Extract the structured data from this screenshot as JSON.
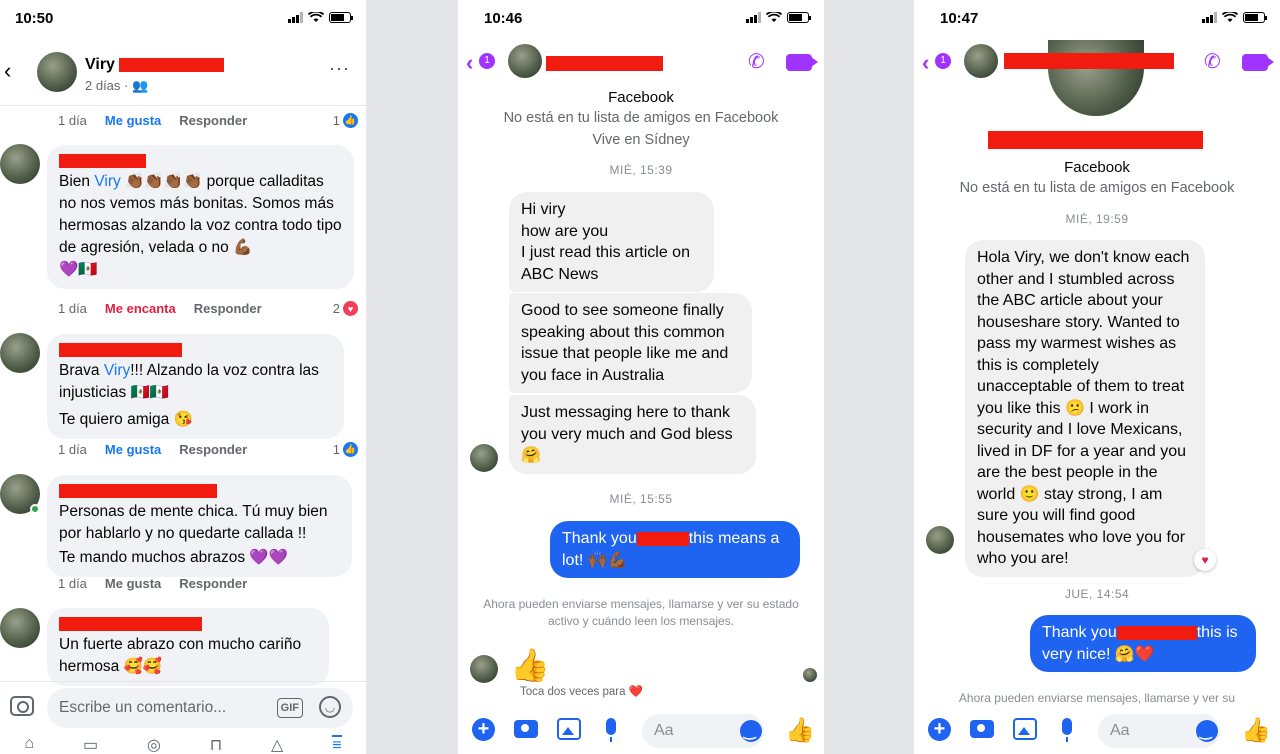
{
  "panel1": {
    "status_time": "10:50",
    "header": {
      "name": "Viry",
      "time": "2 días · ",
      "more": "···"
    },
    "top_meta": {
      "time": "1 día",
      "like": "Me gusta",
      "reply": "Responder",
      "count": "1"
    },
    "comments": [
      {
        "text_parts": [
          "Bien ",
          "Viry",
          " 👏🏾👏🏾👏🏾👏🏾 porque calladitas no nos vemos más bonitas. Somos más hermosas alzando la voz contra todo tipo de agresión, velada o no 💪🏾",
          "💜🇲🇽"
        ],
        "time": "1 día",
        "reaction_label": "Me encanta",
        "reply": "Responder",
        "count": "2"
      },
      {
        "text_parts": [
          "Brava ",
          "Viry",
          "!!! Alzando la voz contra las injusticias 🇲🇽🇲🇽",
          "Te quiero amiga 😘"
        ],
        "time": "1 día",
        "reaction_label": "Me gusta",
        "reply": "Responder",
        "count": "1"
      },
      {
        "lines": [
          "Personas de mente chica. Tú muy bien por hablarlo y no quedarte callada !!",
          "Te mando muchos abrazos 💜💜"
        ],
        "time": "1 día",
        "reaction_label": "Me gusta",
        "reply": "Responder"
      },
      {
        "lines": [
          "Un fuerte abrazo con mucho cariño hermosa 🥰🥰"
        ]
      }
    ],
    "compose_placeholder": "Escribe un comentario...",
    "gif": "GIF"
  },
  "panel2": {
    "status_time": "10:46",
    "badge": "1",
    "profile": {
      "source": "Facebook",
      "not_friends": "No está en tu lista de amigos en Facebook",
      "lives": "Vive en Sídney"
    },
    "stamp1": "MIÉ, 15:39",
    "messages_in": [
      "Hi viry\nhow are you\nI just read this article on ABC News",
      "Good to see someone finally speaking about this common issue that people like me and you face in Australia",
      "Just messaging here to thank you very much and God bless 🤗"
    ],
    "stamp2": "MIÉ, 15:55",
    "message_out": {
      "before": "Thank you",
      "after": "this means a lot! 🙌🏾💪🏾"
    },
    "notice": "Ahora pueden enviarse mensajes, llamarse y ver su estado activo y cuándo leen los mensajes.",
    "double_tap": "Toca dos veces para ❤️",
    "input_placeholder": "Aa"
  },
  "panel3": {
    "status_time": "10:47",
    "badge": "1",
    "profile": {
      "source": "Facebook",
      "not_friends": "No está en tu lista de amigos en Facebook"
    },
    "stamp1": "MIÉ, 19:59",
    "message_in": "Hola Viry, we don't know each other and I stumbled across the ABC article about your houseshare story. Wanted to pass my warmest wishes as this is completely unacceptable of them to treat you like this 😕 I work in security and I love Mexicans, lived in DF for a year and you are the best people in the world 🙂 stay strong, I am sure you will find good housemates who love you for who you are!",
    "stamp2": "JUE, 14:54",
    "message_out": {
      "before": "Thank you",
      "after": "this is very nice! 🤗❤️"
    },
    "notice": "Ahora pueden enviarse mensajes, llamarse y ver su",
    "input_placeholder": "Aa"
  },
  "colors": {
    "fb_blue": "#1877f2",
    "messenger_blue": "#1f63f1",
    "messenger_purple": "#a033ff",
    "redaction": "#f21b10"
  }
}
